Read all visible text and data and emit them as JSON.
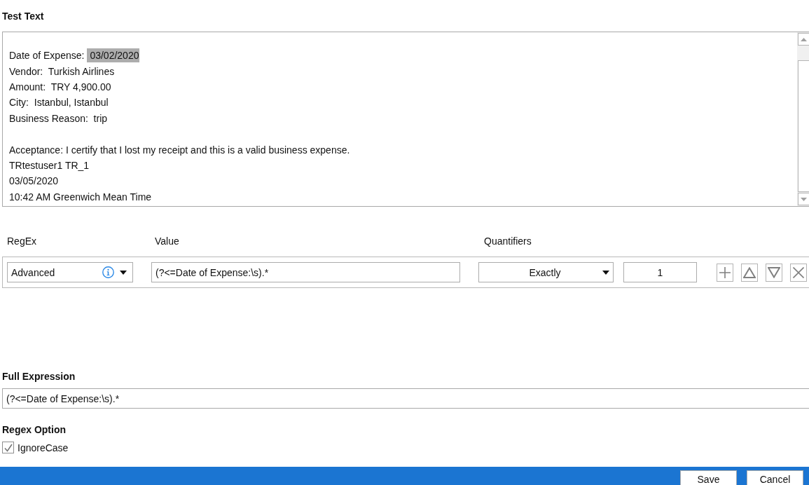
{
  "test_text": {
    "label": "Test Text",
    "paragraphs": [
      {
        "lines": [
          {
            "segments": [
              {
                "text": "Date of Expense:",
                "selected": false
              },
              {
                "text": "03/02/2020",
                "selected": true
              }
            ]
          },
          {
            "segments": [
              {
                "text": "Vendor:  Turkish Airlines",
                "selected": false
              }
            ]
          },
          {
            "segments": [
              {
                "text": "Amount:  TRY 4,900.00",
                "selected": false
              }
            ]
          },
          {
            "segments": [
              {
                "text": "City:  Istanbul, Istanbul",
                "selected": false
              }
            ]
          },
          {
            "segments": [
              {
                "text": "Business Reason:  trip",
                "selected": false
              }
            ]
          }
        ]
      },
      {
        "lines": [
          {
            "segments": [
              {
                "text": "Acceptance: I certify that I lost my receipt and this is a valid business expense.",
                "selected": false
              }
            ]
          },
          {
            "segments": [
              {
                "text": "TRtestuser1 TR_1",
                "selected": false
              }
            ]
          },
          {
            "segments": [
              {
                "text": "03/05/2020",
                "selected": false
              }
            ]
          },
          {
            "segments": [
              {
                "text": "10:42 AM Greenwich Mean Time",
                "selected": false
              }
            ]
          }
        ]
      }
    ]
  },
  "regex": {
    "columns": [
      "RegEx",
      "Value",
      "Quantifiers"
    ],
    "rows": [
      {
        "type": "Advanced",
        "value": "(?<=Date of Expense:\\s).*",
        "quantifier": "Exactly",
        "count": "1"
      }
    ]
  },
  "full_expression": {
    "label": "Full Expression",
    "value": "(?<=Date of Expense:\\s).*"
  },
  "regex_option": {
    "label": "Regex Option",
    "options": [
      {
        "label": "IgnoreCase",
        "checked": true
      }
    ]
  },
  "footer": {
    "buttons": [
      "Save",
      "Cancel"
    ]
  }
}
